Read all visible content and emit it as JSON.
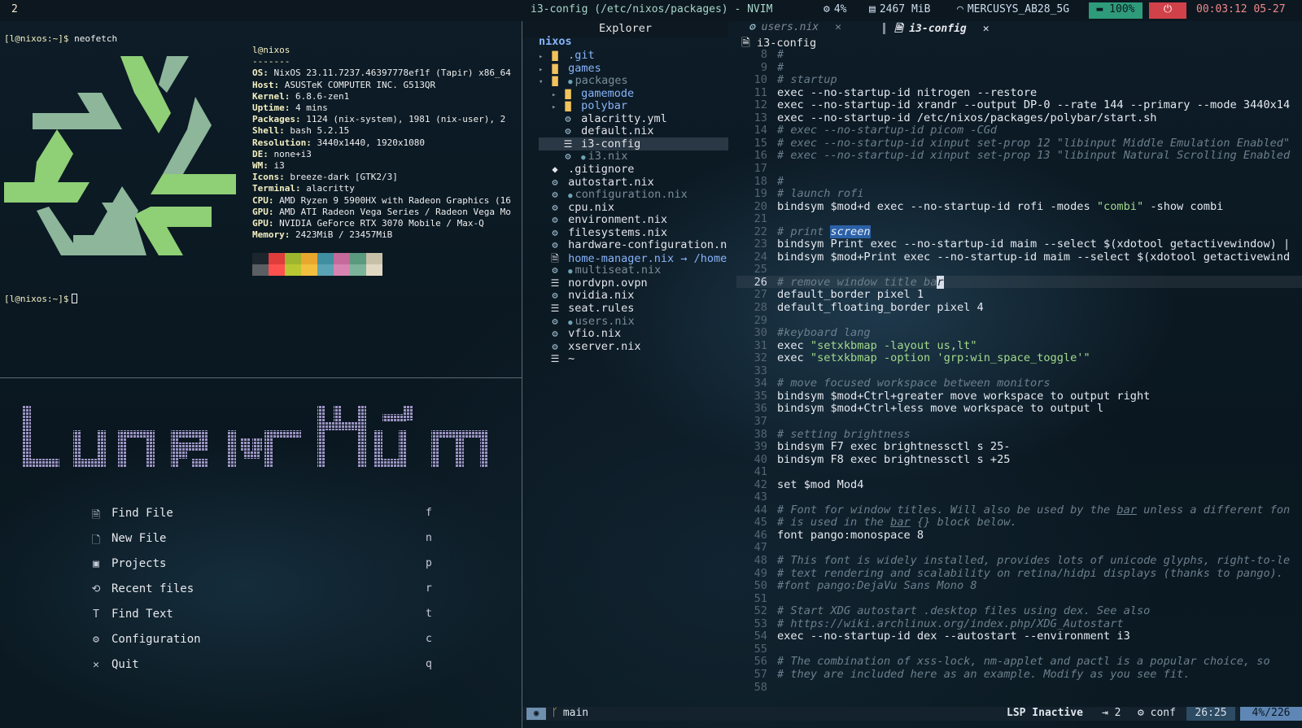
{
  "polybar": {
    "workspace": "2",
    "window_title": "i3-config (/etc/nixos/packages) - NVIM",
    "cpu": "4%",
    "memory": "2467 MiB",
    "wifi": "MERCUSYS_AB28_5G",
    "battery": "100%",
    "clock": "00:03:12 05-27"
  },
  "terminal": {
    "prompt": "[l@nixos:~]$",
    "command": "neofetch",
    "user_host": "l@nixos",
    "separator": "-------",
    "info": [
      {
        "k": "OS",
        "v": "NixOS 23.11.7237.46397778ef1f (Tapir) x86_64"
      },
      {
        "k": "Host",
        "v": "ASUSTeK COMPUTER INC. G513QR"
      },
      {
        "k": "Kernel",
        "v": "6.8.6-zen1"
      },
      {
        "k": "Uptime",
        "v": "4 mins"
      },
      {
        "k": "Packages",
        "v": "1124 (nix-system), 1981 (nix-user), 2"
      },
      {
        "k": "Shell",
        "v": "bash 5.2.15"
      },
      {
        "k": "Resolution",
        "v": "3440x1440, 1920x1080"
      },
      {
        "k": "DE",
        "v": "none+i3"
      },
      {
        "k": "WM",
        "v": "i3"
      },
      {
        "k": "Icons",
        "v": "breeze-dark [GTK2/3]"
      },
      {
        "k": "Terminal",
        "v": "alacritty"
      },
      {
        "k": "CPU",
        "v": "AMD Ryzen 9 5900HX with Radeon Graphics (16"
      },
      {
        "k": "GPU",
        "v": "AMD ATI Radeon Vega Series / Radeon Vega Mo"
      },
      {
        "k": "GPU",
        "v": "NVIDIA GeForce RTX 3070 Mobile / Max-Q"
      },
      {
        "k": "Memory",
        "v": "2423MiB / 23457MiB"
      }
    ],
    "palette": [
      "#1d262d",
      "#e03c3c",
      "#9eb52e",
      "#e8a72d",
      "#3f8fa1",
      "#c56a9a",
      "#5a9a7e",
      "#c6c0a8",
      "#5b5f63",
      "#ff5050",
      "#b8c832",
      "#f3bf3f",
      "#5aa3b4",
      "#d784b3",
      "#7bb49a",
      "#e1d8c4"
    ],
    "colors": {
      "logo_light": "#8fcf76",
      "logo_dark": "#8db69b"
    }
  },
  "dashboard": {
    "items": [
      {
        "icon": "file-search-icon",
        "glyph": "🗎",
        "label": "Find File",
        "key": "f"
      },
      {
        "icon": "new-file-icon",
        "glyph": "🗋",
        "label": "New File",
        "key": "n"
      },
      {
        "icon": "projects-icon",
        "glyph": "▣",
        "label": "Projects",
        "key": "p"
      },
      {
        "icon": "history-icon",
        "glyph": "⟲",
        "label": "Recent files",
        "key": "r"
      },
      {
        "icon": "text-icon",
        "glyph": "T",
        "label": "Find Text",
        "key": "t"
      },
      {
        "icon": "gear-icon",
        "glyph": "⚙",
        "label": "Configuration",
        "key": "c"
      },
      {
        "icon": "close-icon",
        "glyph": "✕",
        "label": "Quit",
        "key": "q"
      }
    ]
  },
  "explorer": {
    "title": "Explorer",
    "root": "nixos",
    "items": [
      {
        "name": ".git",
        "type": "folder",
        "indent": 0,
        "arrow": "▸"
      },
      {
        "name": "games",
        "type": "folder",
        "indent": 0,
        "arrow": "▸"
      },
      {
        "name": "packages",
        "type": "folder-open",
        "indent": 0,
        "arrow": "▾",
        "dot": true,
        "dim": true
      },
      {
        "name": "gamemode",
        "type": "folder",
        "indent": 1,
        "arrow": "▸"
      },
      {
        "name": "polybar",
        "type": "folder",
        "indent": 1,
        "arrow": "▸"
      },
      {
        "name": "alacritty.yml",
        "type": "gear",
        "indent": 1
      },
      {
        "name": "default.nix",
        "type": "gear",
        "indent": 1
      },
      {
        "name": "i3-config",
        "type": "lines",
        "indent": 1,
        "selected": true
      },
      {
        "name": "i3.nix",
        "type": "gear",
        "indent": 1,
        "dot": true,
        "dim": true
      },
      {
        "name": ".gitignore",
        "type": "diamond",
        "indent": 0
      },
      {
        "name": "autostart.nix",
        "type": "gear",
        "indent": 0
      },
      {
        "name": "configuration.nix",
        "type": "gear",
        "indent": 0,
        "dot": true,
        "dim": true
      },
      {
        "name": "cpu.nix",
        "type": "gear",
        "indent": 0
      },
      {
        "name": "environment.nix",
        "type": "gear",
        "indent": 0
      },
      {
        "name": "filesystems.nix",
        "type": "gear",
        "indent": 0
      },
      {
        "name": "hardware-configuration.n",
        "type": "gear",
        "indent": 0
      },
      {
        "name": "home-manager.nix",
        "type": "doc",
        "indent": 0,
        "link": "→ /home",
        "linkname": true
      },
      {
        "name": "multiseat.nix",
        "type": "gear",
        "indent": 0,
        "dot": true,
        "dim": true
      },
      {
        "name": "nordvpn.ovpn",
        "type": "lines",
        "indent": 0
      },
      {
        "name": "nvidia.nix",
        "type": "gear",
        "indent": 0
      },
      {
        "name": "seat.rules",
        "type": "lines",
        "indent": 0
      },
      {
        "name": "users.nix",
        "type": "gear",
        "indent": 0,
        "dot": true,
        "dim": true
      },
      {
        "name": "vfio.nix",
        "type": "gear",
        "indent": 0
      },
      {
        "name": "xserver.nix",
        "type": "gear",
        "indent": 0
      },
      {
        "name": "~",
        "type": "lines",
        "indent": 0
      }
    ]
  },
  "editor": {
    "tabs": [
      {
        "label": "users.nix",
        "active": false,
        "close": "✕"
      },
      {
        "label": "i3-config",
        "active": true,
        "close": "✕"
      }
    ],
    "breadcrumb": "i3-config",
    "lines": [
      {
        "n": "8",
        "t": "#",
        "c": true
      },
      {
        "n": "9",
        "t": "#",
        "c": true
      },
      {
        "n": "10",
        "t": "# startup",
        "c": true
      },
      {
        "n": "11",
        "t": "exec --no-startup-id nitrogen --restore"
      },
      {
        "n": "12",
        "t": "exec --no-startup-id xrandr --output DP-0 --rate 144 --primary --mode 3440x14"
      },
      {
        "n": "13",
        "t": "exec --no-startup-id /etc/nixos/packages/polybar/start.sh"
      },
      {
        "n": "14",
        "t": "# exec --no-startup-id picom -CGd",
        "c": true
      },
      {
        "n": "15",
        "t": "# exec --no-startup-id xinput set-prop 12 \"libinput Middle Emulation Enabled\"",
        "c": true
      },
      {
        "n": "16",
        "t": "# exec --no-startup-id xinput set-prop 13 \"libinput Natural Scrolling Enabled",
        "c": true
      },
      {
        "n": "17",
        "t": ""
      },
      {
        "n": "18",
        "t": "#",
        "c": true
      },
      {
        "n": "19",
        "t": "# launch rofi",
        "c": true
      },
      {
        "n": "20",
        "t": "bindsym $mod+d exec --no-startup-id rofi -modes ",
        "s": "\"combi\"",
        "t2": " -show combi"
      },
      {
        "n": "21",
        "t": ""
      },
      {
        "n": "22",
        "t": "# print ",
        "c": true,
        "h": "screen"
      },
      {
        "n": "23",
        "t": "bindsym Print exec --no-startup-id maim --select $(xdotool getactivewindow) |"
      },
      {
        "n": "24",
        "t": "bindsym $mod+Print exec --no-startup-id maim --select $(xdotool getactivewind"
      },
      {
        "n": "25",
        "t": ""
      },
      {
        "n": "26",
        "t": "# remove window title ba",
        "c": true,
        "cur": true,
        "cursor": "r"
      },
      {
        "n": "27",
        "t": "default_border pixel 1"
      },
      {
        "n": "28",
        "t": "default_floating_border pixel 4"
      },
      {
        "n": "29",
        "t": ""
      },
      {
        "n": "30",
        "t": "#keyboard lang",
        "c": true
      },
      {
        "n": "31",
        "t": "exec ",
        "s": "\"setxkbmap -layout us,lt\"",
        "t2": ""
      },
      {
        "n": "32",
        "t": "exec ",
        "s": "\"setxkbmap -option 'grp:win_space_toggle'\"",
        "t2": ""
      },
      {
        "n": "33",
        "t": ""
      },
      {
        "n": "34",
        "t": "# move focused workspace between monitors",
        "c": true
      },
      {
        "n": "35",
        "t": "bindsym $mod+Ctrl+greater move workspace to output right"
      },
      {
        "n": "36",
        "t": "bindsym $mod+Ctrl+less move workspace to output l"
      },
      {
        "n": "37",
        "t": ""
      },
      {
        "n": "38",
        "t": "# setting brightness",
        "c": true
      },
      {
        "n": "39",
        "t": "bindsym F7 exec brightnessctl s 25-"
      },
      {
        "n": "40",
        "t": "bindsym F8 exec brightnessctl s +25"
      },
      {
        "n": "41",
        "t": ""
      },
      {
        "n": "42",
        "t": "set $mod Mod4"
      },
      {
        "n": "43",
        "t": ""
      },
      {
        "n": "44",
        "t": "# Font for window titles. Will also be used by the ",
        "c": true,
        "u": "bar",
        "t2": " unless a different fon"
      },
      {
        "n": "45",
        "t": "# is used in the ",
        "c": true,
        "u": "bar",
        "t2": " {} block below."
      },
      {
        "n": "46",
        "t": "font pango:monospace 8"
      },
      {
        "n": "47",
        "t": ""
      },
      {
        "n": "48",
        "t": "# This font is widely installed, provides lots of unicode glyphs, right-to-le",
        "c": true
      },
      {
        "n": "49",
        "t": "# text rendering and scalability on retina/hidpi displays (thanks to pango).",
        "c": true
      },
      {
        "n": "50",
        "t": "#font pango:DejaVu Sans Mono 8",
        "c": true
      },
      {
        "n": "51",
        "t": ""
      },
      {
        "n": "52",
        "t": "# Start XDG autostart .desktop files using dex. See also",
        "c": true
      },
      {
        "n": "53",
        "t": "# https://wiki.archlinux.org/index.php/XDG_Autostart",
        "c": true
      },
      {
        "n": "54",
        "t": "exec --no-startup-id dex --autostart --environment i3"
      },
      {
        "n": "55",
        "t": ""
      },
      {
        "n": "56",
        "t": "# The combination of xss-lock, nm-applet and pactl is a popular choice, so",
        "c": true
      },
      {
        "n": "57",
        "t": "# they are included here as an example. Modify as you see fit.",
        "c": true
      },
      {
        "n": "58",
        "t": ""
      }
    ]
  },
  "statusline": {
    "branch": "main",
    "lsp": "LSP Inactive",
    "indent": "⇥ 2",
    "filetype": "conf",
    "position": "26:25",
    "percent": "4%/226"
  }
}
